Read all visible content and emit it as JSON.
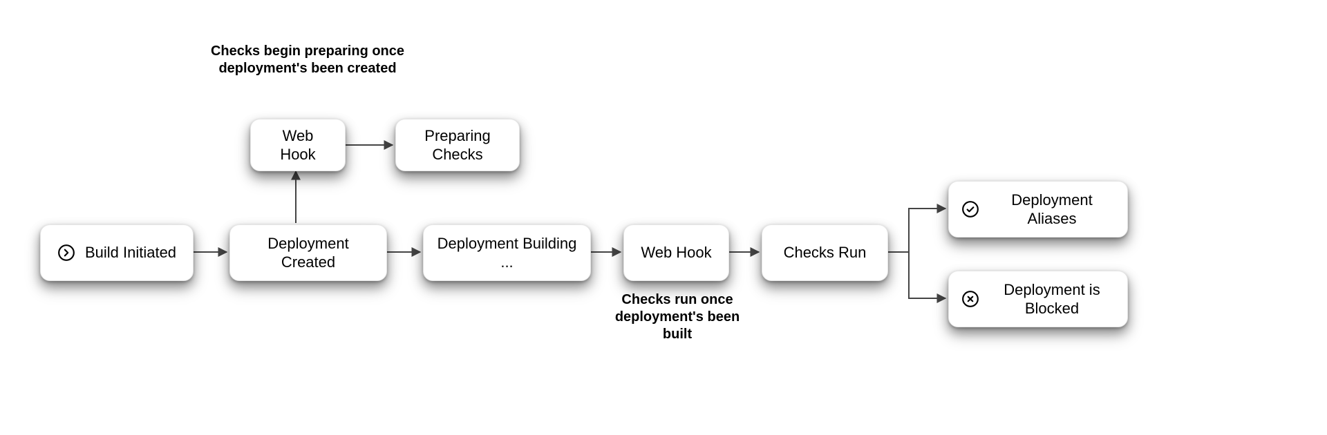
{
  "captions": {
    "top": "Checks begin preparing once deployment's been created",
    "bottom": "Checks run once deployment's been built"
  },
  "nodes": {
    "build_initiated": "Build Initiated",
    "deployment_created": "Deployment Created",
    "web_hook_top": "Web Hook",
    "preparing_checks": "Preparing Checks",
    "deployment_building": "Deployment Building ...",
    "web_hook_mid": "Web Hook",
    "checks_run": "Checks Run",
    "deployment_aliases": "Deployment Aliases",
    "deployment_blocked": "Deployment is Blocked"
  },
  "chart_data": {
    "type": "flowchart",
    "nodes": [
      {
        "id": "build_initiated",
        "label": "Build Initiated",
        "icon": "arrow-right-circle"
      },
      {
        "id": "deployment_created",
        "label": "Deployment Created"
      },
      {
        "id": "web_hook_top",
        "label": "Web Hook"
      },
      {
        "id": "preparing_checks",
        "label": "Preparing Checks"
      },
      {
        "id": "deployment_building",
        "label": "Deployment Building ..."
      },
      {
        "id": "web_hook_mid",
        "label": "Web Hook"
      },
      {
        "id": "checks_run",
        "label": "Checks Run"
      },
      {
        "id": "deployment_aliases",
        "label": "Deployment Aliases",
        "icon": "check-circle"
      },
      {
        "id": "deployment_blocked",
        "label": "Deployment is Blocked",
        "icon": "x-circle"
      }
    ],
    "edges": [
      {
        "from": "build_initiated",
        "to": "deployment_created"
      },
      {
        "from": "deployment_created",
        "to": "web_hook_top"
      },
      {
        "from": "web_hook_top",
        "to": "preparing_checks"
      },
      {
        "from": "deployment_created",
        "to": "deployment_building"
      },
      {
        "from": "deployment_building",
        "to": "web_hook_mid"
      },
      {
        "from": "web_hook_mid",
        "to": "checks_run"
      },
      {
        "from": "checks_run",
        "to": "deployment_aliases"
      },
      {
        "from": "checks_run",
        "to": "deployment_blocked"
      }
    ],
    "annotations": [
      {
        "text": "Checks begin preparing once deployment's been created",
        "near": "web_hook_top",
        "position": "above"
      },
      {
        "text": "Checks run once deployment's been built",
        "near": "web_hook_mid",
        "position": "below"
      }
    ]
  }
}
